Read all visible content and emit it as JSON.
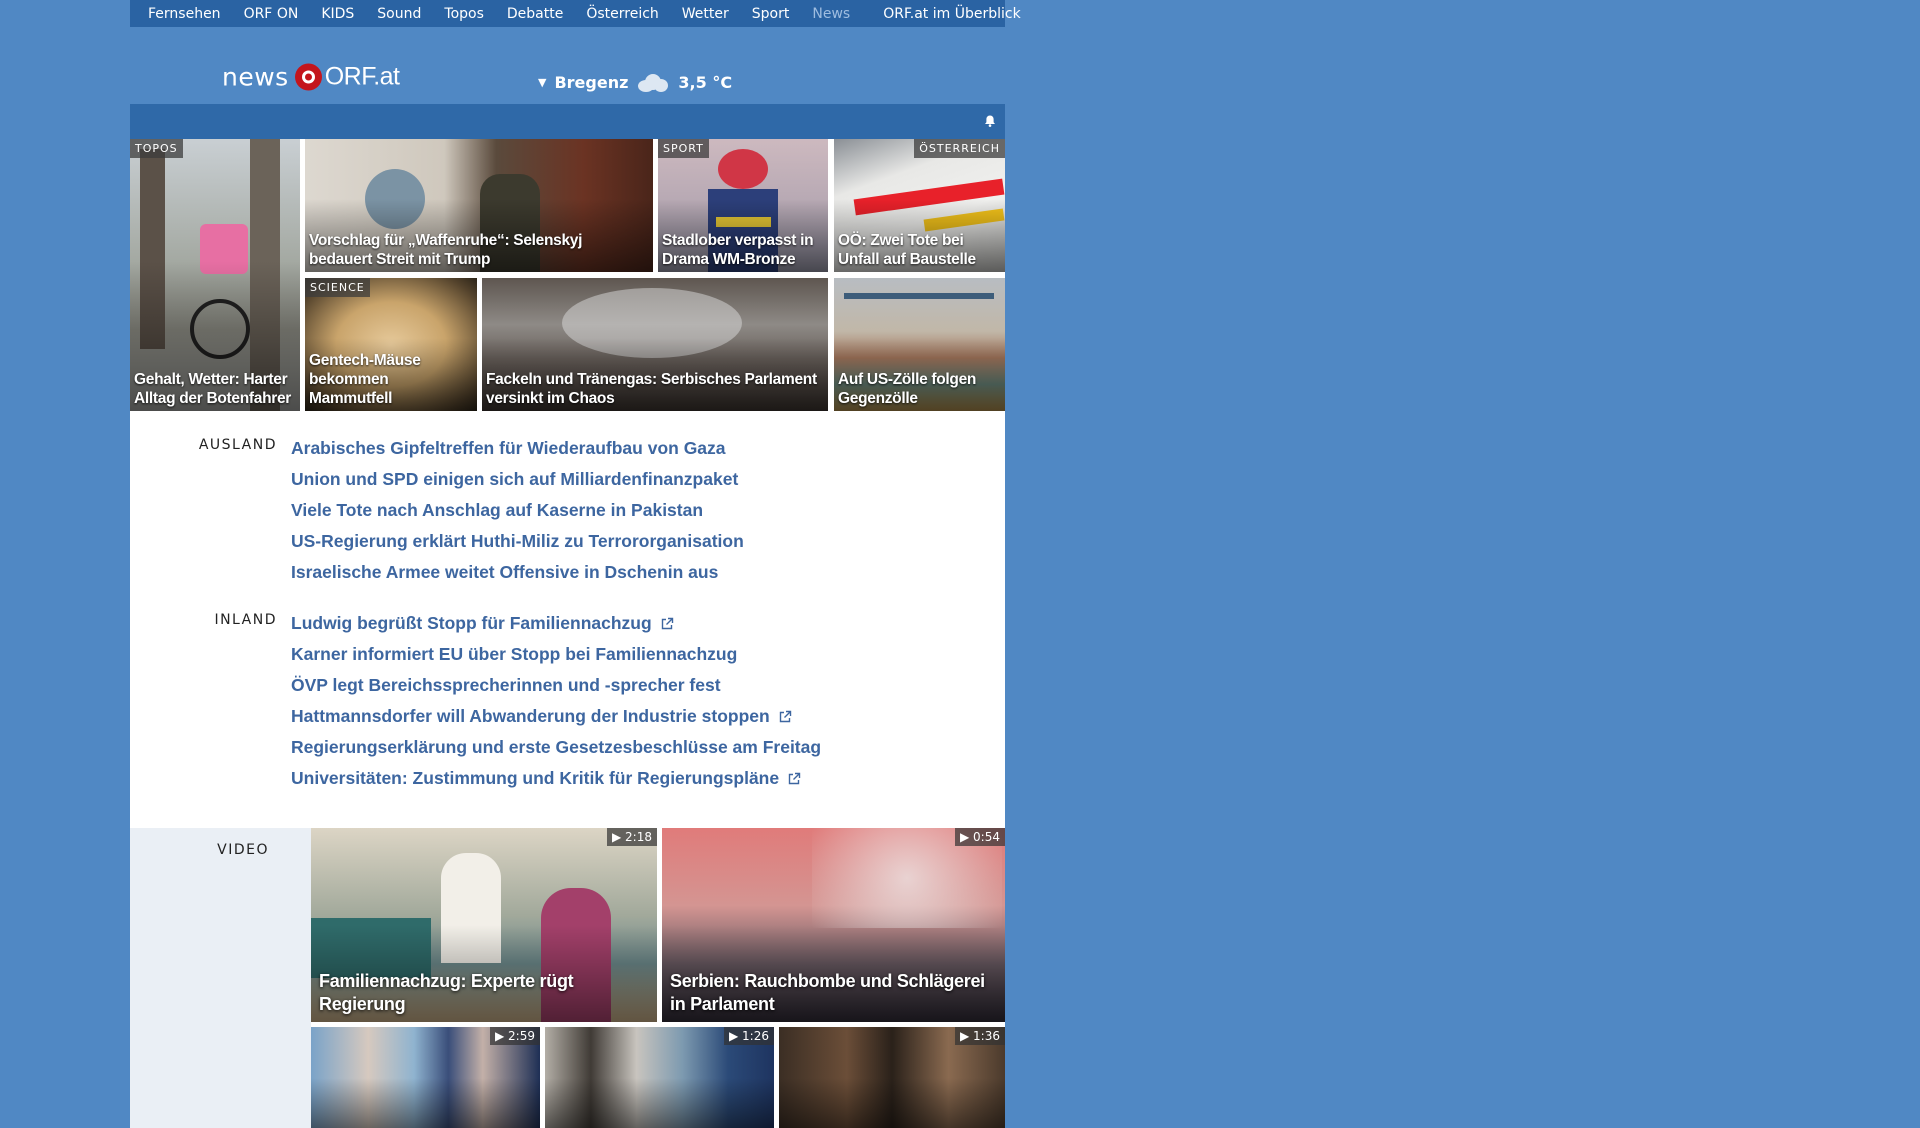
{
  "topnav": {
    "items": [
      "Fernsehen",
      "ORF ON",
      "KIDS",
      "Sound",
      "Topos",
      "Debatte",
      "Österreich",
      "Wetter",
      "Sport",
      "News"
    ],
    "active": "News",
    "overview": "ORF.at im Überblick"
  },
  "header": {
    "logo_news": "news",
    "logo_orf": "ORF.at",
    "weather": {
      "city": "Bregenz",
      "temp": "3,5 °C",
      "icon": "cloud-icon"
    }
  },
  "tiles": [
    {
      "tag": "TOPOS",
      "caption": "Gehalt, Wetter: Harter Alltag der Botenfahrer",
      "tag_side": "left"
    },
    {
      "tag": "",
      "caption": "Vorschlag für „Waffenruhe“: Selenskyj bedauert Streit mit Trump",
      "tag_side": "left"
    },
    {
      "tag": "SPORT",
      "caption": "Stadlober verpasst in Drama WM-Bronze",
      "tag_side": "left"
    },
    {
      "tag": "ÖSTERREICH",
      "caption": "OÖ: Zwei Tote bei Unfall auf Baustelle",
      "tag_side": "right"
    },
    {
      "tag": "SCIENCE",
      "caption": "Gentech-Mäuse bekommen Mammutfell",
      "tag_side": "left"
    },
    {
      "tag": "",
      "caption": "Fackeln und Tränengas: Serbisches Parlament versinkt im Chaos",
      "tag_side": "left"
    },
    {
      "tag": "",
      "caption": "Auf US-Zölle folgen Gegenzölle",
      "tag_side": "left"
    }
  ],
  "sections": {
    "ausland": {
      "label": "AUSLAND",
      "items": [
        {
          "text": "Arabisches Gipfeltreffen für Wiederaufbau von Gaza",
          "external": false
        },
        {
          "text": "Union und SPD einigen sich auf Milliardenfinanzpaket",
          "external": false
        },
        {
          "text": "Viele Tote nach Anschlag auf Kaserne in Pakistan",
          "external": false
        },
        {
          "text": "US-Regierung erklärt Huthi-Miliz zu Terrororganisation",
          "external": false
        },
        {
          "text": "Israelische Armee weitet Offensive in Dschenin aus",
          "external": false
        }
      ]
    },
    "inland": {
      "label": "INLAND",
      "items": [
        {
          "text": "Ludwig begrüßt Stopp für Familiennachzug",
          "external": true
        },
        {
          "text": "Karner informiert EU über Stopp bei Familiennachzug",
          "external": false
        },
        {
          "text": "ÖVP legt Bereichssprecherinnen und -sprecher fest",
          "external": false
        },
        {
          "text": "Hattmannsdorfer will Abwanderung der Industrie stoppen",
          "external": true
        },
        {
          "text": "Regierungserklärung und erste Gesetzesbeschlüsse am Freitag",
          "external": false
        },
        {
          "text": "Universitäten: Zustimmung und Kritik für Regierungspläne",
          "external": true
        }
      ]
    }
  },
  "video": {
    "label": "VIDEO",
    "items": [
      {
        "duration": "2:18",
        "caption": "Familiennachzug: Experte rügt Regierung"
      },
      {
        "duration": "0:54",
        "caption": "Serbien: Rauchbombe und Schlägerei in Parlament"
      },
      {
        "duration": "2:59",
        "caption": ""
      },
      {
        "duration": "1:26",
        "caption": ""
      },
      {
        "duration": "1:36",
        "caption": ""
      }
    ]
  },
  "colors": {
    "background": "#5088c4",
    "topnav": "#2a63a3",
    "link": "#3d66a0",
    "brand_red": "#c4151c"
  }
}
